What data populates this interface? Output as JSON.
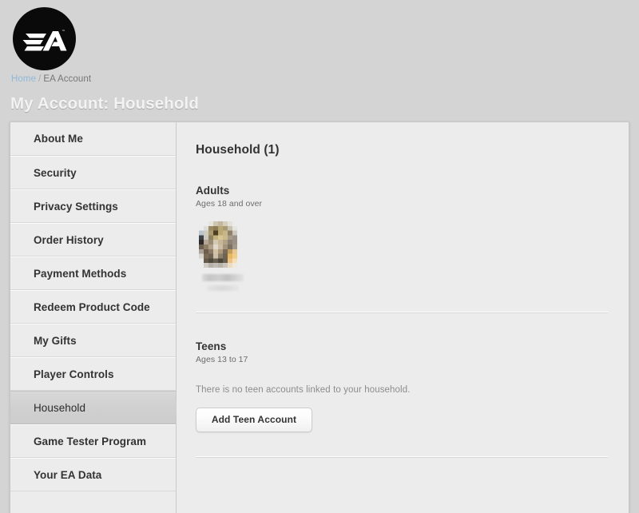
{
  "header": {
    "logo_icon": "ea-logo-icon",
    "breadcrumb": {
      "home_label": "Home",
      "separator": "/",
      "current_label": "EA Account"
    },
    "title": "My Account: Household"
  },
  "sidebar": {
    "items": [
      {
        "label": "About Me",
        "active": false
      },
      {
        "label": "Security",
        "active": false
      },
      {
        "label": "Privacy Settings",
        "active": false
      },
      {
        "label": "Order History",
        "active": false
      },
      {
        "label": "Payment Methods",
        "active": false
      },
      {
        "label": "Redeem Product Code",
        "active": false
      },
      {
        "label": "My Gifts",
        "active": false
      },
      {
        "label": "Player Controls",
        "active": false
      },
      {
        "label": "Household",
        "active": true
      },
      {
        "label": "Game Tester Program",
        "active": false
      },
      {
        "label": "Your EA Data",
        "active": false
      }
    ]
  },
  "main": {
    "title": "Household (1)",
    "adults": {
      "heading": "Adults",
      "subtext": "Ages 18 and over",
      "members": [
        {
          "name_redacted": true,
          "avatar": "pixelated-user-avatar"
        }
      ]
    },
    "teens": {
      "heading": "Teens",
      "subtext": "Ages 13 to 17",
      "empty_message": "There is no teen accounts linked to your household.",
      "add_button_label": "Add Teen Account"
    }
  },
  "colors": {
    "page_background": "#d4d4d4",
    "card_background": "#ececec",
    "link_blue": "#8fb9d9",
    "text_primary": "#333333",
    "text_muted": "#8c8c8c",
    "active_nav": "#cfcfcf"
  }
}
